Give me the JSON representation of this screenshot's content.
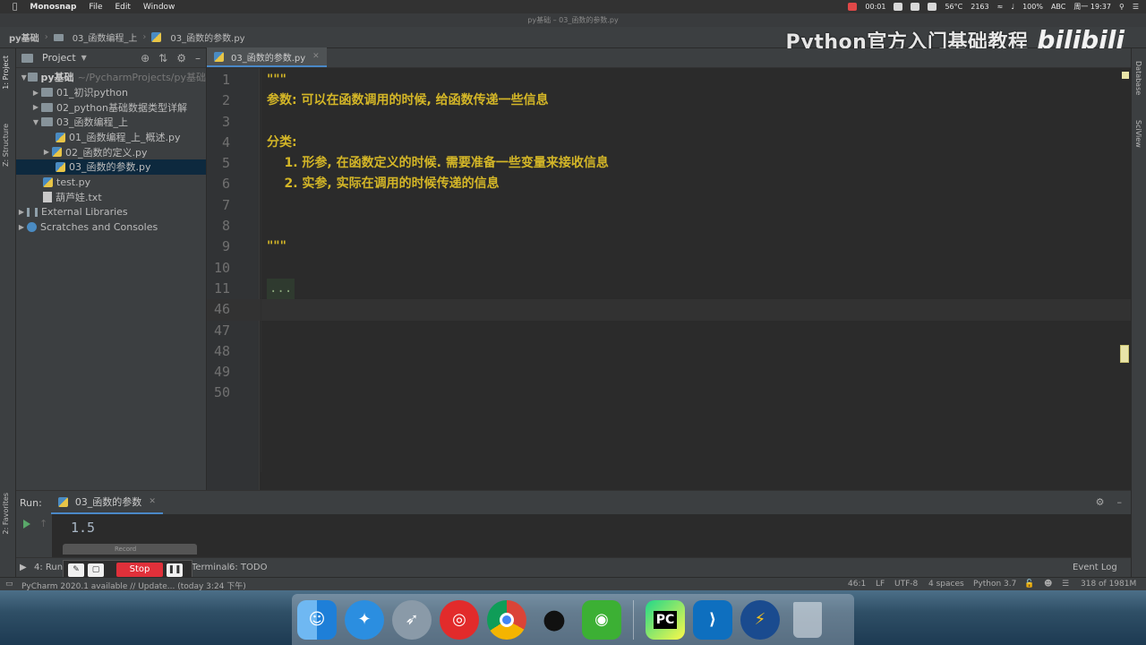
{
  "menubar": {
    "app": "Monosnap",
    "menus": [
      "File",
      "Edit",
      "Window"
    ],
    "status": {
      "timer": "00:01",
      "temp": "56°C",
      "fan": "2163",
      "battery": "100%",
      "input": "ABC",
      "clock": "周一 19:37"
    }
  },
  "titlebar": {
    "title": "py基础 – 03_函数的参数.py"
  },
  "navbar": {
    "crumbs": [
      "py基础",
      "03_函数编程_上",
      "03_函数的参数.py"
    ]
  },
  "watermark": {
    "text": "Python官方入门基础教程",
    "logo": "bilibili"
  },
  "left_strip": {
    "project_tab": "1: Project",
    "structure_tab": "Z: Structure",
    "favorites_tab": "2: Favorites"
  },
  "right_strip": {
    "database_tab": "Database",
    "sciview_tab": "SciView"
  },
  "project": {
    "header": "Project",
    "root": {
      "name": "py基础",
      "path": "~/PycharmProjects/py基础"
    },
    "items": [
      {
        "label": "01_初识python"
      },
      {
        "label": "02_python基础数据类型详解"
      },
      {
        "label": "03_函数编程_上"
      },
      {
        "label": "01_函数编程_上_概述.py"
      },
      {
        "label": "02_函数的定义.py"
      },
      {
        "label": "03_函数的参数.py"
      },
      {
        "label": "test.py"
      },
      {
        "label": "葫芦娃.txt"
      },
      {
        "label": "External Libraries"
      },
      {
        "label": "Scratches and Consoles"
      }
    ]
  },
  "editor": {
    "tab": "03_函数的参数.py",
    "lines": [
      {
        "no": "1",
        "text": "\"\"\""
      },
      {
        "no": "2",
        "text": "参数: 可以在函数调用的时候, 给函数传递一些信息"
      },
      {
        "no": "3",
        "text": ""
      },
      {
        "no": "4",
        "text": "分类:"
      },
      {
        "no": "5",
        "text": "    1. 形参, 在函数定义的时候. 需要准备一些变量来接收信息"
      },
      {
        "no": "6",
        "text": "    2. 实参, 实际在调用的时候传递的信息"
      },
      {
        "no": "7",
        "text": ""
      },
      {
        "no": "8",
        "text": ""
      },
      {
        "no": "9",
        "text": "\"\"\""
      },
      {
        "no": "10",
        "text": ""
      },
      {
        "no": "11",
        "text": "..."
      },
      {
        "no": "46",
        "text": ""
      },
      {
        "no": "47",
        "text": ""
      },
      {
        "no": "48",
        "text": ""
      },
      {
        "no": "49",
        "text": ""
      },
      {
        "no": "50",
        "text": ""
      }
    ]
  },
  "run": {
    "label": "Run:",
    "config": "03_函数的参数",
    "output": "1.5"
  },
  "recorder": {
    "title": "Record",
    "stop": "Stop"
  },
  "tooltabs": {
    "run": "4: Run",
    "terminal": "Terminal",
    "todo": "6: TODO",
    "eventlog": "Event Log"
  },
  "status": {
    "message": "PyCharm 2020.1 available // Update... (today 3:24 下午)",
    "position": "46:1",
    "line_sep": "LF",
    "encoding": "UTF-8",
    "indent": "4 spaces",
    "interpreter": "Python 3.7",
    "memory": "318 of 1981M"
  },
  "dock": {
    "apps": [
      "finder-icon",
      "safari-icon",
      "launchpad-icon",
      "netease-music-icon",
      "chrome-icon",
      "qq-icon",
      "wechat-icon",
      "pycharm-icon",
      "vscode-icon",
      "reeder-icon",
      "trash-icon"
    ]
  },
  "colors": {
    "accent": "#4a88c7",
    "docstring": "#d4b627",
    "background": "#2b2b2b",
    "panel": "#3c3f41"
  }
}
